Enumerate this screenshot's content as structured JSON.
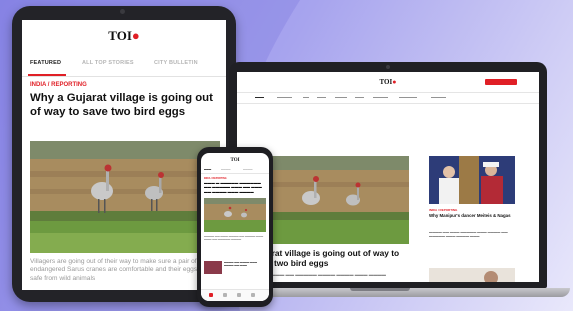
{
  "colors": {
    "accent": "#e01f26",
    "background": "#a7a4ee"
  },
  "tablet": {
    "logo": "TOI",
    "tabs": [
      {
        "label": "FEATURED",
        "active": true
      },
      {
        "label": "ALL TOP STORIES",
        "active": false
      },
      {
        "label": "CITY BULLETIN",
        "active": false
      }
    ],
    "kicker": "INDIA / REPORTING",
    "headline": "Why a Gujarat village is going out of way to save two bird eggs",
    "caption": "Villagers are going out of their way to make sure a pair of endangered Sarus cranes are comfortable and their eggs are safe from wild animals"
  },
  "laptop": {
    "logo": "TOI",
    "headline": "Gujarat village is going out of way to save two bird eggs",
    "side_kicker": "INDIA / REPORTING",
    "side_title": "Why Manipur's dancer Meiteis & Nagas"
  },
  "phone": {
    "logo": "TOI",
    "kicker": "INDIA / REPORTING"
  }
}
